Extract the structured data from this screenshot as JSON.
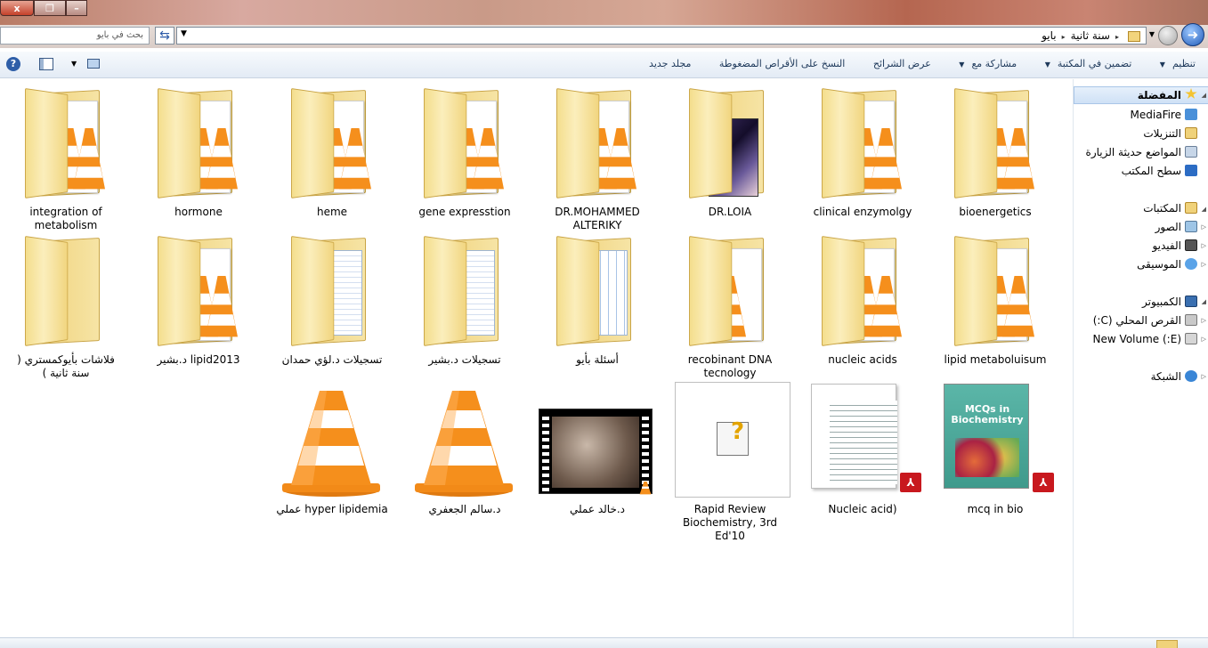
{
  "window": {
    "close_glyph": "x",
    "restore_glyph": "❐",
    "min_glyph": "–"
  },
  "address": {
    "search_placeholder": "بحث في بايو",
    "crumbs": [
      "سنة ثانية",
      "بايو"
    ],
    "separator": "▸"
  },
  "toolbar": {
    "organize": "تنظيم",
    "include_library": "تضمين في المكتبة",
    "share_with": "مشاركة مع",
    "slideshow": "عرض الشرائح",
    "burn": "النسخ على الأقراص المضغوطة",
    "new_folder": "مجلد جديد",
    "dropdown": "▼"
  },
  "items": [
    {
      "label": "integration of metabolism",
      "kind": "folder-vlc"
    },
    {
      "label": "hormone",
      "kind": "folder-vlc"
    },
    {
      "label": "heme",
      "kind": "folder-vlc"
    },
    {
      "label": "gene expresstion",
      "kind": "folder-vlc"
    },
    {
      "label": "DR.MOHAMMED ALTERIKY",
      "kind": "folder-vlc"
    },
    {
      "label": "DR.LOIA",
      "kind": "folder-dark"
    },
    {
      "label": "clinical enzymolgy",
      "kind": "folder-vlc"
    },
    {
      "label": "bioenergetics",
      "kind": "folder-vlc"
    },
    {
      "label": "فلاشات بأيوكمستري ( سنة ثانية )",
      "kind": "folder-empty"
    },
    {
      "label": "lipid2013 د.بشير",
      "kind": "folder-vlc"
    },
    {
      "label": "تسجيلات د.لؤي حمدان",
      "kind": "folder-docs"
    },
    {
      "label": "تسجيلات د.بشير",
      "kind": "folder-docs"
    },
    {
      "label": "أسئلة بأيو",
      "kind": "folder-sheet"
    },
    {
      "label": "recobinant DNA tecnology",
      "kind": "folder-cone"
    },
    {
      "label": "nucleic acids",
      "kind": "folder-vlc"
    },
    {
      "label": "lipid metaboluisum",
      "kind": "folder-vlc"
    },
    {
      "label": "hyper lipidemia عملي",
      "kind": "vlc"
    },
    {
      "label": "د.سالم الجعفري",
      "kind": "vlc"
    },
    {
      "label": "د.خالد عملي",
      "kind": "video"
    },
    {
      "label": "Rapid Review Biochemistry, 3rd Ed'10",
      "kind": "unknown"
    },
    {
      "label": "Nucleic acid)",
      "kind": "pdf"
    },
    {
      "label": "mcq in bio",
      "kind": "pdf-book",
      "cover_title": "MCQs in Biochemistry"
    }
  ],
  "nav": {
    "favorites": "المفضلة",
    "mediafire": "MediaFire",
    "downloads": "التنزيلات",
    "recent": "المواضع حديثة الزيارة",
    "desktop": "سطح المكتب",
    "libraries": "المكتبات",
    "pictures": "الصور",
    "videos": "الفيديو",
    "music": "الموسيقى",
    "computer": "الكمبيوتر",
    "local_disk": "القرص المحلي (C:)",
    "new_volume": "(E:) New Volume",
    "network": "الشبكة"
  },
  "colors": {
    "accent": "#1e395b",
    "folder": "#f0d27a",
    "vlc_orange": "#f08a1c",
    "pdf_red": "#c8181e"
  }
}
